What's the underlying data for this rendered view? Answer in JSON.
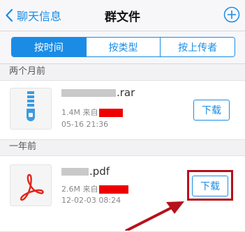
{
  "nav": {
    "back_label": "聊天信息",
    "title": "群文件"
  },
  "tabs": [
    {
      "label": "按时间",
      "active": true
    },
    {
      "label": "按类型",
      "active": false
    },
    {
      "label": "按上传者",
      "active": false
    }
  ],
  "sections": [
    {
      "header": "两个月前",
      "file": {
        "ext": ".rar",
        "size": "1.4M",
        "from_label": "来自",
        "date": "05-16 21:36",
        "action": "下载",
        "icon": "zip-archive-icon"
      }
    },
    {
      "header": "一年前",
      "file": {
        "ext": ".pdf",
        "size": "2.6M",
        "from_label": "来自",
        "date": "12-02-03 08:24",
        "action": "下载",
        "icon": "pdf-icon"
      }
    }
  ],
  "colors": {
    "accent": "#1a8ce6",
    "redact": "#ee0000",
    "highlight": "#b5121b"
  }
}
